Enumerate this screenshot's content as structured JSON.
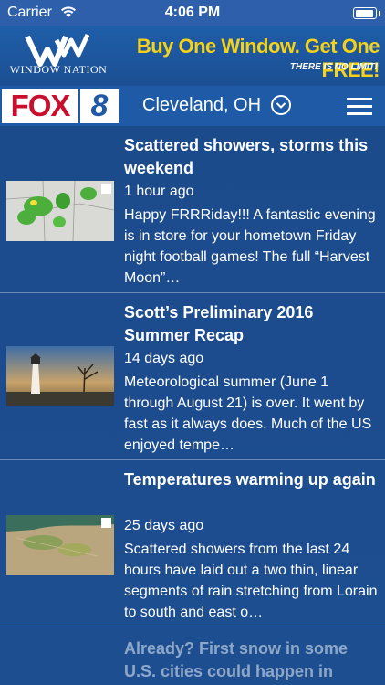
{
  "status_bar": {
    "carrier": "Carrier",
    "time": "4:06 PM",
    "icons": [
      "wifi-icon",
      "battery-icon"
    ]
  },
  "ad": {
    "brand": "WINDOW NATION",
    "headline": "Buy One Window. Get One FREE!",
    "tagline": "THERE IS NO LIMIT!",
    "headline_color": "#f5d21a"
  },
  "nav": {
    "logo_fox": "FOX",
    "logo_number": "8",
    "location": "Cleveland, OH",
    "icons": [
      "chevron-down-icon",
      "menu-icon"
    ]
  },
  "articles": [
    {
      "title": "Scattered showers, storms this weekend",
      "age": "1 hour ago",
      "summary": "Happy FRRRiday!!! A fantastic evening is in store for your hometown Friday night football games! The full “Harvest Moon”…",
      "thumb": "radar-map-thumbnail"
    },
    {
      "title": "Scott’s Preliminary 2016 Summer Recap",
      "age": "14 days ago",
      "summary": "Meteorological summer (June 1 through August 21) is over.  It went by fast as it always does.  Much of the US enjoyed tempe…",
      "thumb": "lighthouse-photo-thumbnail"
    },
    {
      "title": "Temperatures warming up again",
      "age": "25 days ago",
      "summary": "Scattered showers from the last 24 hours have laid out a two thin, linear segments of rain stretching from Lorain to south and east o…",
      "thumb": "rainfall-map-thumbnail"
    }
  ],
  "next_article_title": "Already? First snow in some U.S. cities could happen in"
}
